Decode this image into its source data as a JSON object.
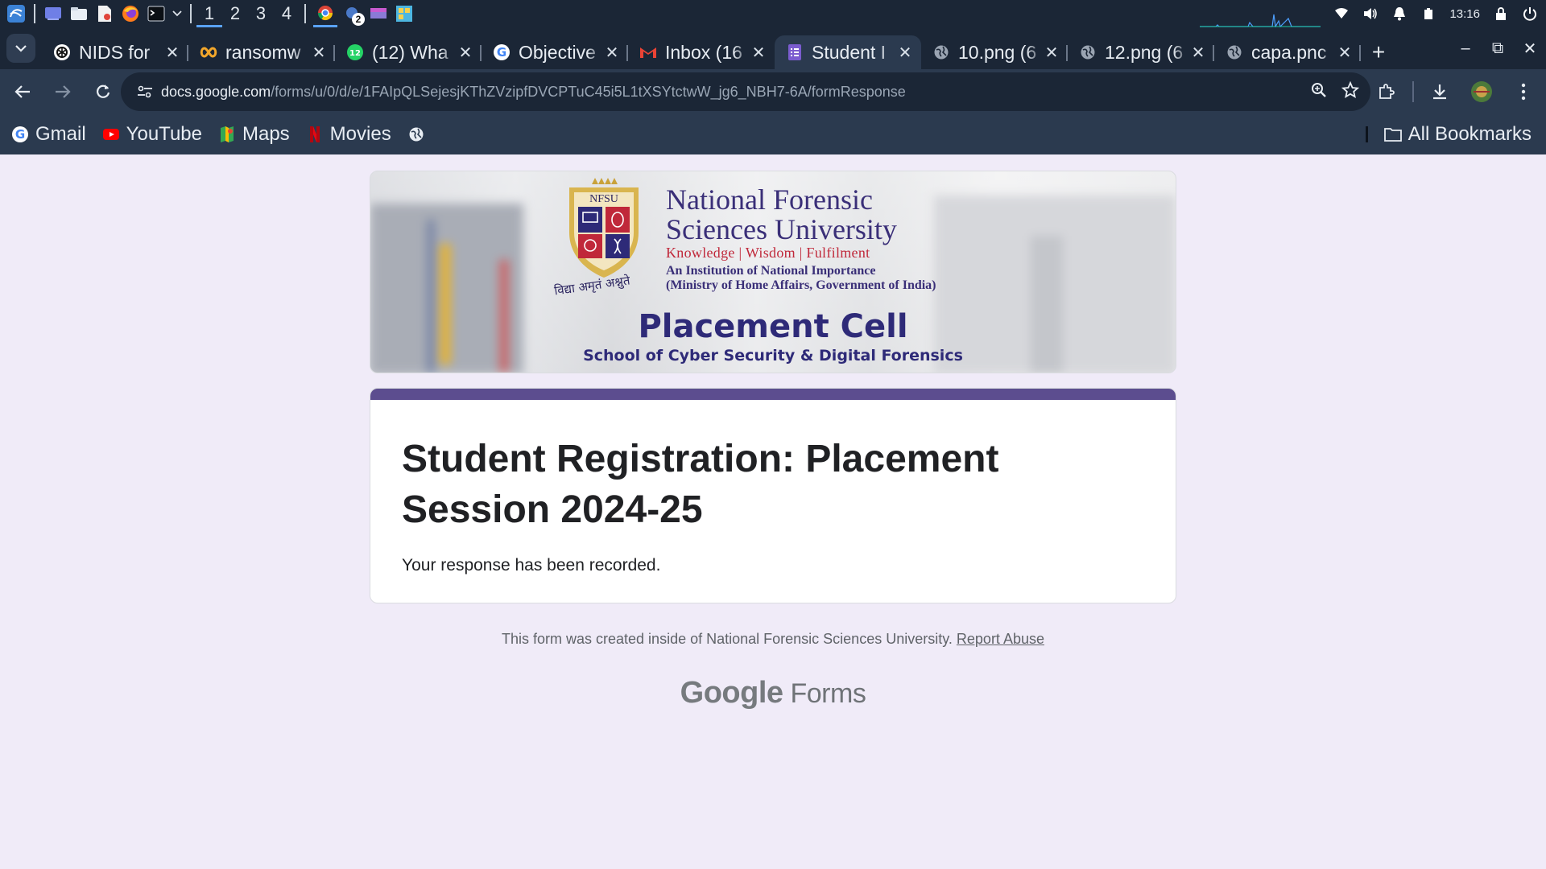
{
  "os": {
    "workspaces": [
      "1",
      "2",
      "3",
      "4"
    ],
    "active_workspace": "1",
    "chrome_badge": "2",
    "clock": "13:16",
    "tray_icons": [
      "wifi-icon",
      "volume-icon",
      "bell-icon",
      "battery-icon",
      "lock-icon",
      "power-icon"
    ]
  },
  "tabs": [
    {
      "title": "NIDS for",
      "icon": "openai-icon"
    },
    {
      "title": "ransomw",
      "icon": "infinity-icon"
    },
    {
      "title": "(12) Wha",
      "icon": "whatsapp-icon"
    },
    {
      "title": "Objective",
      "icon": "google-icon"
    },
    {
      "title": "Inbox (16",
      "icon": "gmail-icon"
    },
    {
      "title": "Student I",
      "icon": "forms-icon",
      "active": true
    },
    {
      "title": "10.png (6",
      "icon": "globe-icon"
    },
    {
      "title": "12.png (6",
      "icon": "globe-icon"
    },
    {
      "title": "capa.pnc",
      "icon": "globe-icon"
    }
  ],
  "toolbar": {
    "url_host": "docs.google.com",
    "url_path": "/forms/u/0/d/e/1FAIpQLSejesjKThZVzipfDVCPTuC45i5L1tXSYtctwW_jg6_NBH7-6A/formResponse"
  },
  "bookmarks": {
    "items": [
      {
        "label": "Gmail",
        "icon": "google-g-icon"
      },
      {
        "label": "YouTube",
        "icon": "youtube-icon"
      },
      {
        "label": "Maps",
        "icon": "maps-icon"
      },
      {
        "label": "Movies",
        "icon": "netflix-icon"
      },
      {
        "label": "",
        "icon": "globe-icon"
      }
    ],
    "all_bookmarks": "All Bookmarks"
  },
  "banner": {
    "crest_text": "NFSU",
    "university_line1": "National Forensic",
    "university_line2": "Sciences University",
    "motto": "Knowledge | Wisdom | Fulfilment",
    "institution_line1": "An Institution of National Importance",
    "institution_line2": "(Ministry of Home Affairs, Government of India)",
    "hindi_motto": "विद्या अमृतं अश्नुते",
    "title": "Placement Cell",
    "subtitle": "School of Cyber Security  & Digital Forensics",
    "colors": {
      "navy": "#2e2a78",
      "red": "#c0283a",
      "gold": "#c9a23a"
    }
  },
  "form": {
    "title": "Student Registration: Placement Session 2024-25",
    "message": "Your response has been recorded.",
    "accent_color": "#5c4d8f"
  },
  "footer": {
    "text": "This form was created inside of National Forensic Sciences University.",
    "report_link": "Report Abuse",
    "brand_google": "Google",
    "brand_forms": "Forms"
  }
}
